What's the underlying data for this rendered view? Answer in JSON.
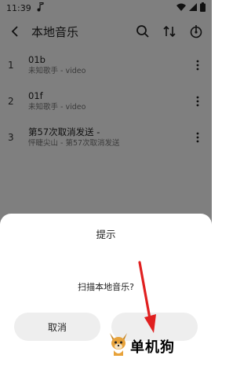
{
  "status": {
    "time": "11:39",
    "music_icon": "music-note-icon",
    "wifi_icon": "wifi-icon",
    "signal_icon": "signal-icon",
    "battery_icon": "battery-icon"
  },
  "header": {
    "title": "本地音乐",
    "back_icon": "back-arrow-icon",
    "search_icon": "search-icon",
    "sort_icon": "sort-icon",
    "scan_icon": "scan-icon"
  },
  "tracks": [
    {
      "index": "1",
      "title": "01b",
      "subtitle": "未知歌手 - video"
    },
    {
      "index": "2",
      "title": "01f",
      "subtitle": "未知歌手 - video"
    },
    {
      "index": "3",
      "title": "第57次取消发送 -",
      "subtitle": "怦睫尖山 - 第57次取消发送"
    }
  ],
  "dialog": {
    "title": "提示",
    "message": "扫描本地音乐?",
    "cancel_label": "取消",
    "confirm_label": ""
  },
  "watermark": {
    "text": "单机狗"
  },
  "colors": {
    "scrim": "#00000080",
    "button_bg": "#eeeeee",
    "arrow": "#e02020"
  }
}
